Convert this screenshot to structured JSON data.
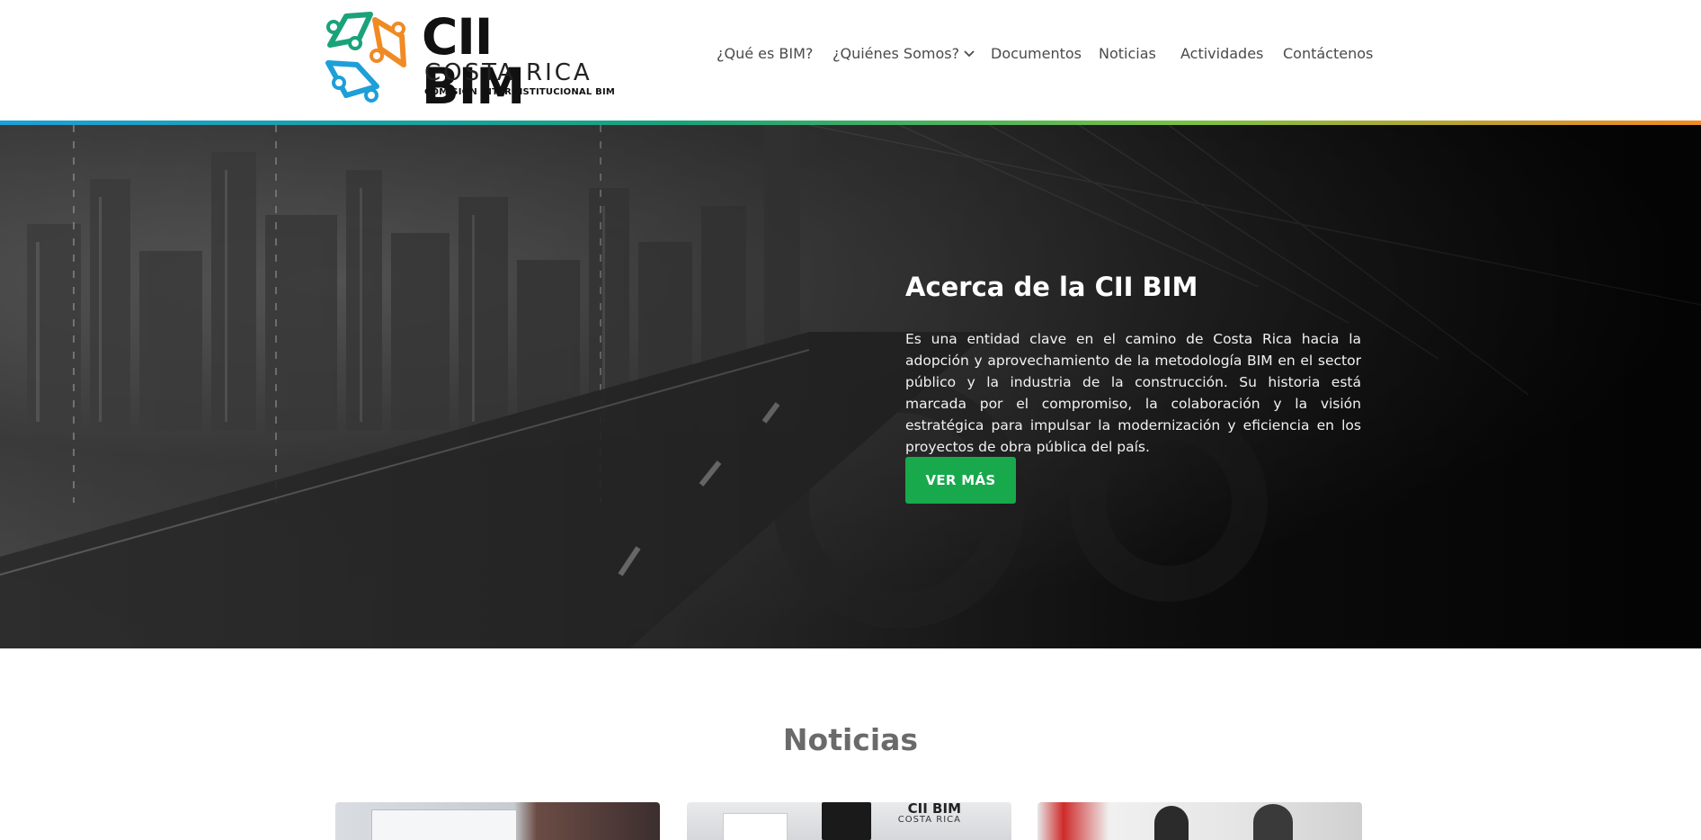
{
  "logo": {
    "title": "CII BIM",
    "subtitle": "COSTA RICA",
    "tagline": "COMISIÓN INTERINSTITUCIONAL BIM"
  },
  "nav": {
    "items": [
      {
        "label": "¿Qué es BIM?"
      },
      {
        "label": "¿Quiénes Somos?"
      },
      {
        "label": "Documentos"
      },
      {
        "label": "Noticias"
      },
      {
        "label": "Actividades"
      },
      {
        "label": "Contáctenos"
      }
    ]
  },
  "hero": {
    "title": "Acerca de la CII BIM",
    "text": "Es una entidad clave en el camino de Costa Rica hacia la adopción y aprovechamiento de la metodología BIM en el sector público y la industria de la construcción. Su historia está marcada por el compromiso, la colaboración y la visión estratégica para impulsar la modernización y eficiencia en los proyectos de obra pública del país.",
    "button_label": "VER MÁS"
  },
  "news": {
    "title": "Noticias",
    "card2_logo_title": "CII BIM",
    "card2_logo_subtitle": "COSTA RICA"
  },
  "colors": {
    "accent_green": "#18a94c",
    "brand_blue": "#1e9fd8",
    "brand_orange": "#f08a24",
    "brand_teal": "#1aa27a"
  },
  "icons": {
    "dropdown": "chevron-down-icon",
    "logo": "cii-bim-logo-icon"
  }
}
